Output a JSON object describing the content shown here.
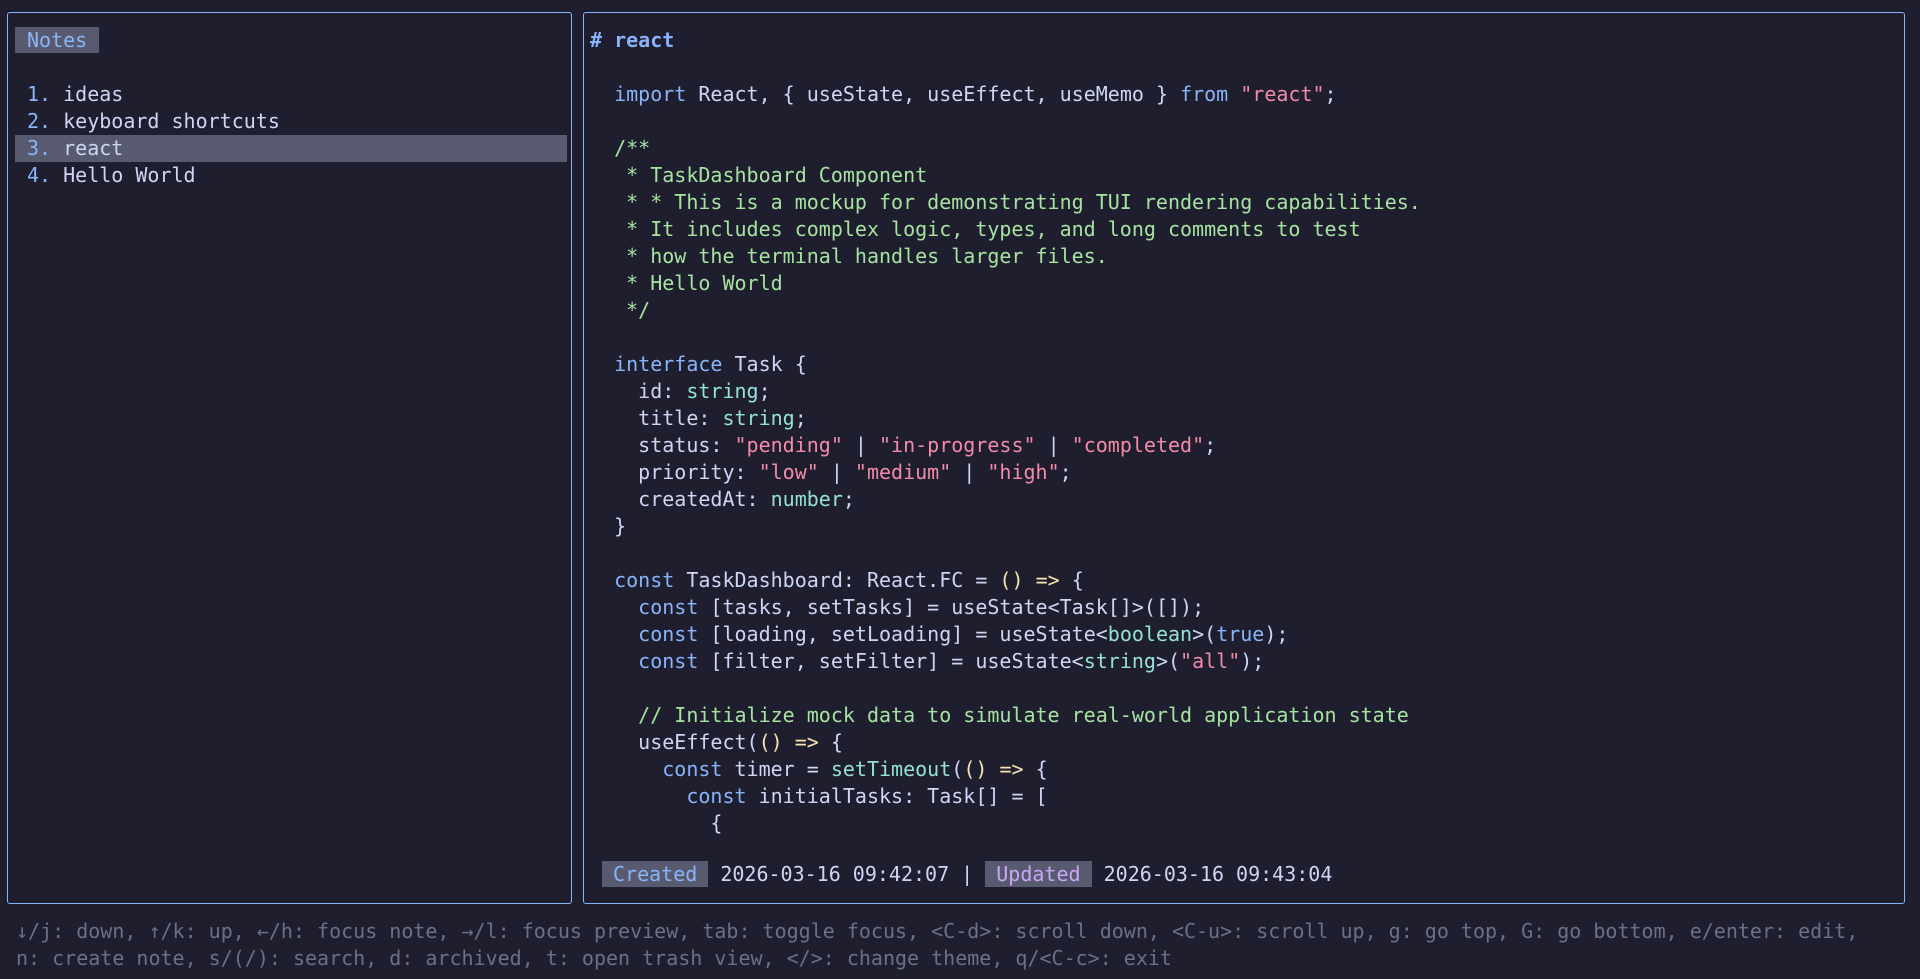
{
  "notes_pane": {
    "title": "Notes",
    "items": [
      {
        "num": "1.",
        "label": "ideas",
        "selected": false
      },
      {
        "num": "2.",
        "label": "keyboard shortcuts",
        "selected": false
      },
      {
        "num": "3.",
        "label": "react",
        "selected": true
      },
      {
        "num": "4.",
        "label": "Hello World",
        "selected": false
      }
    ]
  },
  "preview": {
    "heading": "# react",
    "lines": [
      [
        {
          "t": "  "
        },
        {
          "t": "import",
          "c": "kw"
        },
        {
          "t": " React, { useState, useEffect, useMemo } "
        },
        {
          "t": "from",
          "c": "kw"
        },
        {
          "t": " "
        },
        {
          "t": "\"react\"",
          "c": "str"
        },
        {
          "t": ";"
        }
      ],
      [],
      [
        {
          "t": "  /**",
          "c": "cm"
        }
      ],
      [
        {
          "t": "   * TaskDashboard Component",
          "c": "cm"
        }
      ],
      [
        {
          "t": "   * * This is a mockup for demonstrating TUI rendering capabilities.",
          "c": "cm"
        }
      ],
      [
        {
          "t": "   * It includes complex logic, types, and long comments to test",
          "c": "cm"
        }
      ],
      [
        {
          "t": "   * how the terminal handles larger files.",
          "c": "cm"
        }
      ],
      [
        {
          "t": "   * Hello World",
          "c": "cm"
        }
      ],
      [
        {
          "t": "   */",
          "c": "cm"
        }
      ],
      [],
      [
        {
          "t": "  "
        },
        {
          "t": "interface",
          "c": "kw"
        },
        {
          "t": " Task {"
        }
      ],
      [
        {
          "t": "    id: "
        },
        {
          "t": "string",
          "c": "ty"
        },
        {
          "t": ";"
        }
      ],
      [
        {
          "t": "    title: "
        },
        {
          "t": "string",
          "c": "ty"
        },
        {
          "t": ";"
        }
      ],
      [
        {
          "t": "    status: "
        },
        {
          "t": "\"pending\"",
          "c": "str"
        },
        {
          "t": " | "
        },
        {
          "t": "\"in-progress\"",
          "c": "str"
        },
        {
          "t": " | "
        },
        {
          "t": "\"completed\"",
          "c": "str"
        },
        {
          "t": ";"
        }
      ],
      [
        {
          "t": "    priority: "
        },
        {
          "t": "\"low\"",
          "c": "str"
        },
        {
          "t": " | "
        },
        {
          "t": "\"medium\"",
          "c": "str"
        },
        {
          "t": " | "
        },
        {
          "t": "\"high\"",
          "c": "str"
        },
        {
          "t": ";"
        }
      ],
      [
        {
          "t": "    createdAt: "
        },
        {
          "t": "number",
          "c": "ty"
        },
        {
          "t": ";"
        }
      ],
      [
        {
          "t": "  }"
        }
      ],
      [],
      [
        {
          "t": "  "
        },
        {
          "t": "const",
          "c": "kw"
        },
        {
          "t": " TaskDashboard: React.FC = "
        },
        {
          "t": "()",
          "c": "par"
        },
        {
          "t": " "
        },
        {
          "t": "=>",
          "c": "op"
        },
        {
          "t": " {"
        }
      ],
      [
        {
          "t": "    "
        },
        {
          "t": "const",
          "c": "kw"
        },
        {
          "t": " [tasks, setTasks] = useState<Task[]>([]);"
        }
      ],
      [
        {
          "t": "    "
        },
        {
          "t": "const",
          "c": "kw"
        },
        {
          "t": " [loading, setLoading] = useState<"
        },
        {
          "t": "boolean",
          "c": "ty"
        },
        {
          "t": ">("
        },
        {
          "t": "true",
          "c": "kw"
        },
        {
          "t": ");"
        }
      ],
      [
        {
          "t": "    "
        },
        {
          "t": "const",
          "c": "kw"
        },
        {
          "t": " [filter, setFilter] = useState<"
        },
        {
          "t": "string",
          "c": "ty"
        },
        {
          "t": ">("
        },
        {
          "t": "\"all\"",
          "c": "str"
        },
        {
          "t": ");"
        }
      ],
      [],
      [
        {
          "t": "    // Initialize mock data to simulate real-world application state",
          "c": "cm"
        }
      ],
      [
        {
          "t": "    useEffect("
        },
        {
          "t": "()",
          "c": "par"
        },
        {
          "t": " "
        },
        {
          "t": "=>",
          "c": "op"
        },
        {
          "t": " {"
        }
      ],
      [
        {
          "t": "      "
        },
        {
          "t": "const",
          "c": "kw"
        },
        {
          "t": " timer = "
        },
        {
          "t": "setTimeout",
          "c": "fn"
        },
        {
          "t": "("
        },
        {
          "t": "()",
          "c": "par"
        },
        {
          "t": " "
        },
        {
          "t": "=>",
          "c": "op"
        },
        {
          "t": " {"
        }
      ],
      [
        {
          "t": "        "
        },
        {
          "t": "const",
          "c": "kw"
        },
        {
          "t": " initialTasks: Task[] = ["
        }
      ],
      [
        {
          "t": "          {"
        }
      ]
    ],
    "created_label": "Created",
    "created_value": "2026-03-16 09:42:07",
    "separator": "|",
    "updated_label": "Updated",
    "updated_value": "2026-03-16 09:43:04"
  },
  "help": {
    "line1": "↓/j: down, ↑/k: up, ←/h: focus note, →/l: focus preview, tab: toggle focus, <C-d>: scroll down, <C-u>: scroll up, g: go top, G: go bottom, e/enter: edit,",
    "line2": "n: create note, s/(/): search, d: archived, t: open trash view, </>: change theme, q/<C-c>: exit"
  }
}
